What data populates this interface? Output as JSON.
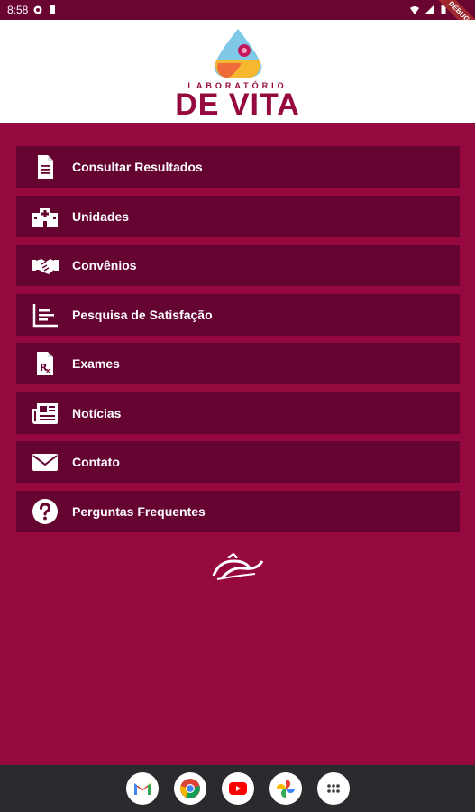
{
  "status_bar": {
    "time": "8:58",
    "debug_label": "DEBUG"
  },
  "header": {
    "logo_small": "LABORATÓRIO",
    "logo_big": "DE VITA"
  },
  "menu": {
    "items": [
      {
        "label": "Consultar Resultados",
        "icon": "document-icon"
      },
      {
        "label": "Unidades",
        "icon": "hospital-icon"
      },
      {
        "label": "Convênios",
        "icon": "handshake-icon"
      },
      {
        "label": "Pesquisa de Satisfação",
        "icon": "chart-icon"
      },
      {
        "label": "Exames",
        "icon": "prescription-icon"
      },
      {
        "label": "Notícias",
        "icon": "newspaper-icon"
      },
      {
        "label": "Contato",
        "icon": "envelope-icon"
      },
      {
        "label": "Perguntas Frequentes",
        "icon": "question-icon"
      }
    ]
  },
  "dock": {
    "apps": [
      "gmail-icon",
      "chrome-icon",
      "youtube-icon",
      "photos-icon",
      "app-drawer-icon"
    ]
  },
  "colors": {
    "background": "#96093f",
    "menu_item": "#650331",
    "status_bar": "#6a0532",
    "brand": "#96093f"
  }
}
